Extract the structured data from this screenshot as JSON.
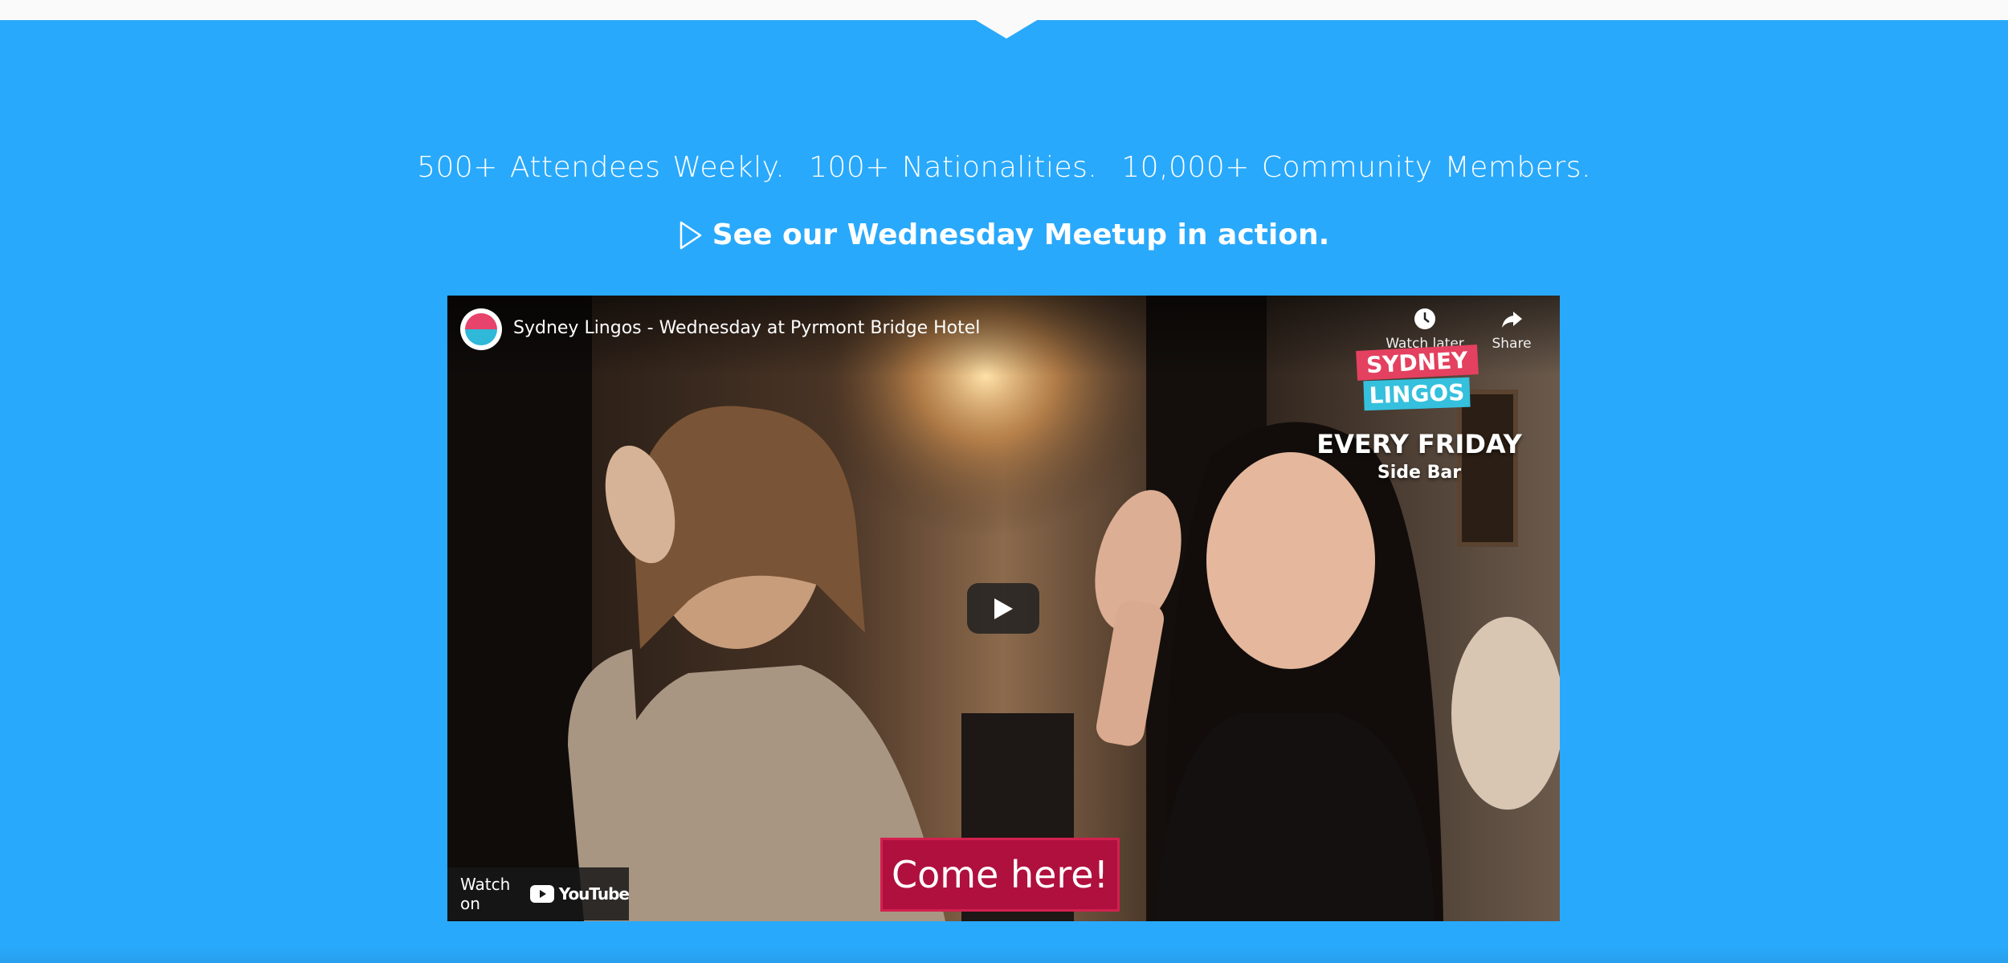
{
  "colors": {
    "background": "#29a9fb",
    "topbar": "#fafafa",
    "come_here_bg": "#b0103e",
    "brand_pink": "#e4405f",
    "brand_cyan": "#35c0dd"
  },
  "section": {
    "stats": "500+ Attendees Weekly.  100+ Nationalities.  10,000+ Community Members.",
    "cta_icon": "play-outline-icon",
    "cta": "See our Wednesday Meetup in action."
  },
  "video": {
    "title": "Sydney Lingos - Wednesday at Pyrmont Bridge Hotel",
    "channel_logo_icon": "channel-avatar-icon",
    "watch_later_label": "Watch later",
    "watch_later_icon": "clock-icon",
    "share_label": "Share",
    "share_icon": "share-arrow-icon",
    "play_icon": "play-icon",
    "overlay": {
      "brand_line1": "SYDNEY",
      "brand_line2": "LINGOS",
      "headline": "EVERY FRIDAY",
      "subline": "Side Bar",
      "banner": "Come here!"
    },
    "watch_on_label": "Watch on",
    "youtube_label": "YouTube",
    "youtube_icon": "youtube-logo-icon"
  }
}
